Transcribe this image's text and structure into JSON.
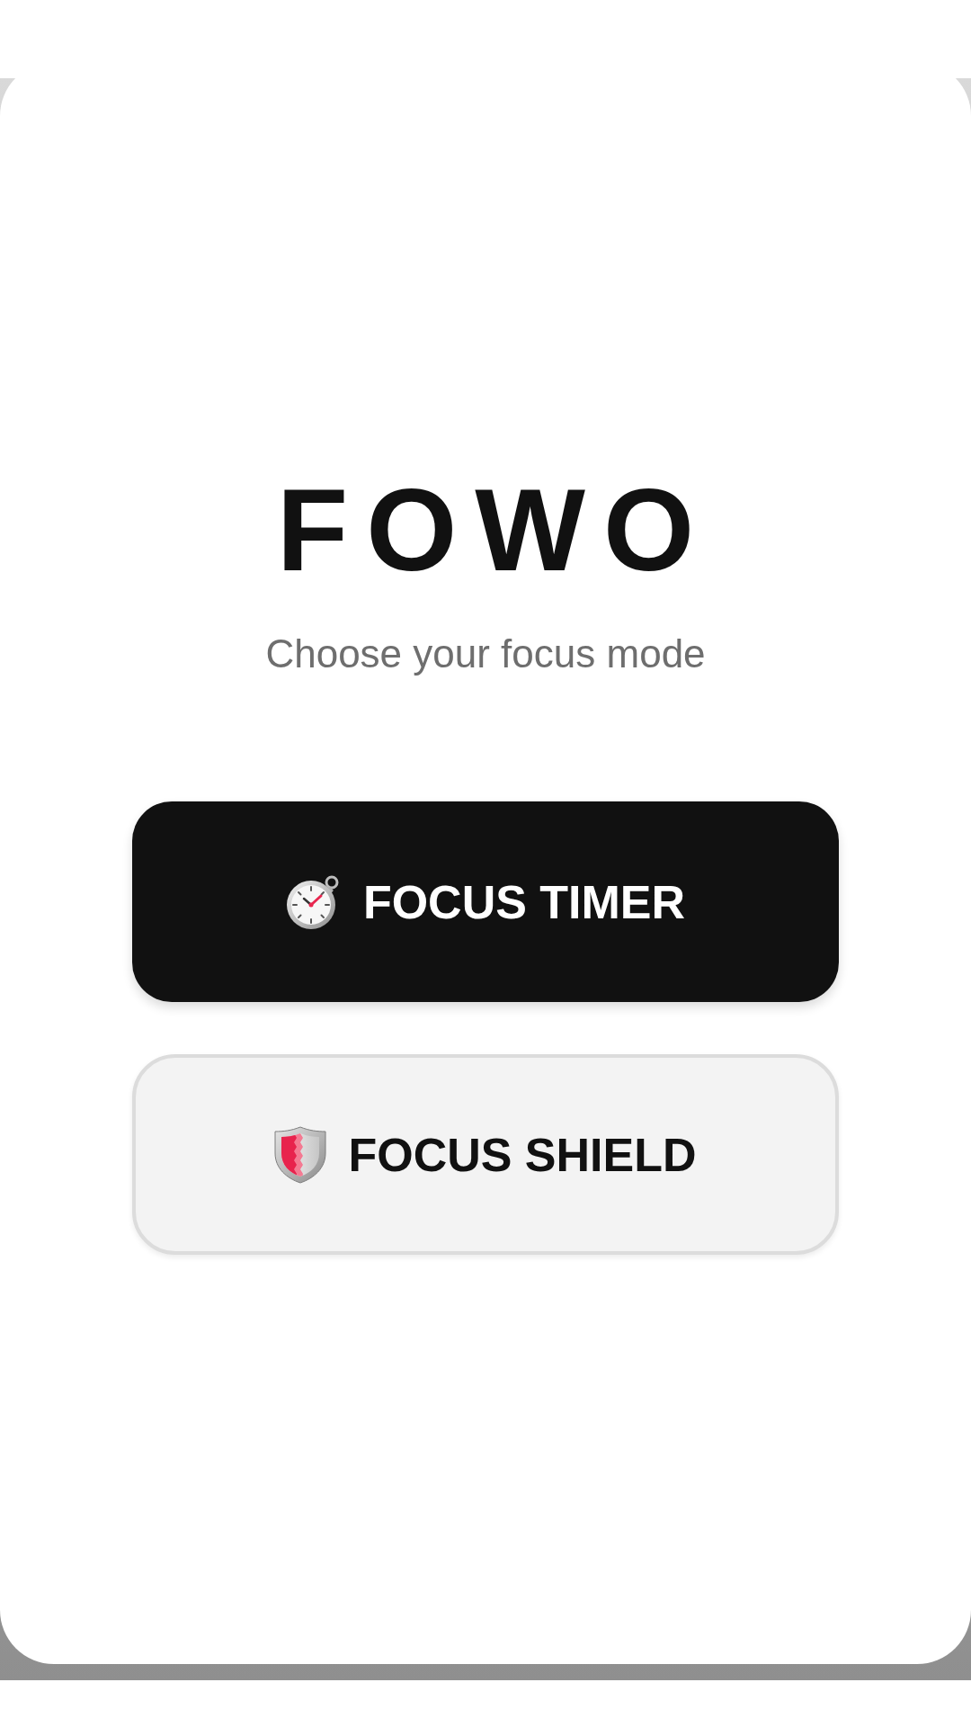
{
  "app": {
    "title": "FOWO",
    "subtitle": "Choose your focus mode"
  },
  "mode_buttons": [
    {
      "label": "FOCUS TIMER",
      "kind": "primary"
    },
    {
      "label": "FOCUS SHIELD",
      "kind": "secondary"
    }
  ]
}
